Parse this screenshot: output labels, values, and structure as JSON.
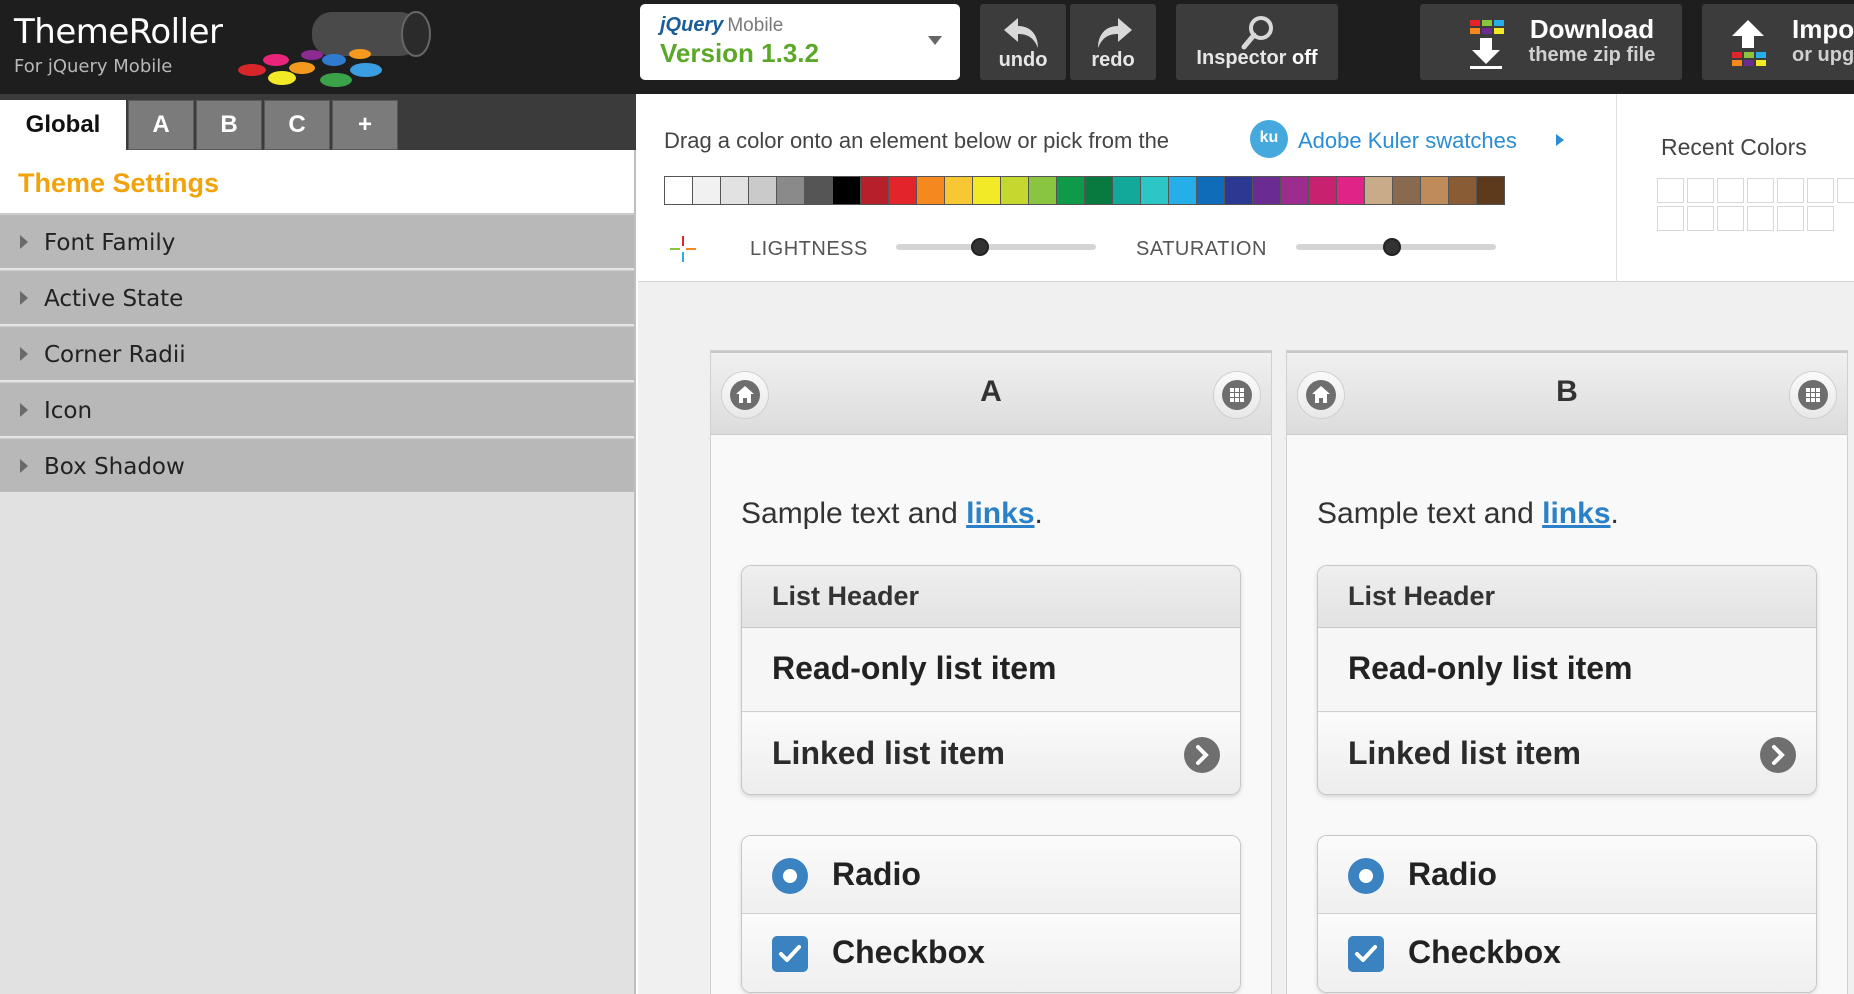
{
  "app": {
    "title": "ThemeRoller",
    "subtitle": "For jQuery Mobile"
  },
  "version": {
    "brand": "jQuery",
    "product": "Mobile",
    "label": "Version 1.3.2"
  },
  "toolbar": {
    "undo": "undo",
    "redo": "redo",
    "inspector": "Inspector",
    "inspector_state": "off",
    "download_main": "Download",
    "download_sub": "theme zip file",
    "import_main": "Impo",
    "import_sub": "or upg"
  },
  "left": {
    "tabs": [
      "Global",
      "A",
      "B",
      "C",
      "+"
    ],
    "active_tab": "Global",
    "settings_title": "Theme Settings",
    "sections": [
      "Font Family",
      "Active State",
      "Corner Radii",
      "Icon",
      "Box Shadow"
    ]
  },
  "palette": {
    "instruction": "Drag a color onto an element below or pick from the",
    "kuler_badge": "ku",
    "kuler_link": "Adobe Kuler swatches",
    "swatches": [
      "#ffffff",
      "#f1f1f1",
      "#e2e2e2",
      "#cacaca",
      "#8a8a8a",
      "#555555",
      "#000000",
      "#b71f2a",
      "#e3242b",
      "#f5891f",
      "#f8c834",
      "#f2ea27",
      "#c5d82f",
      "#8ac542",
      "#0e9a48",
      "#087a3f",
      "#12a89a",
      "#2dc6c6",
      "#25aee7",
      "#0f6cb8",
      "#2c3993",
      "#6a2c91",
      "#9c2d8f",
      "#c8216f",
      "#e02487",
      "#c9ab8a",
      "#8a6a4f",
      "#c08b5a",
      "#8a5c35",
      "#5e3a1c"
    ],
    "lightness_label": "LIGHTNESS",
    "lightness_value": 0.42,
    "saturation_label": "SATURATION",
    "saturation_value": 0.48,
    "recent_title": "Recent Colors"
  },
  "preview": {
    "themes": [
      {
        "title": "A",
        "sample_prefix": "Sample text and ",
        "sample_link": "links",
        "sample_suffix": ".",
        "list_header": "List Header",
        "readonly_item": "Read-only list item",
        "linked_item": "Linked list item",
        "radio": "Radio",
        "checkbox": "Checkbox"
      },
      {
        "title": "B",
        "sample_prefix": "Sample text and ",
        "sample_link": "links",
        "sample_suffix": ".",
        "list_header": "List Header",
        "readonly_item": "Read-only list item",
        "linked_item": "Linked list item",
        "radio": "Radio",
        "checkbox": "Checkbox"
      }
    ]
  },
  "icons": {
    "undo": "undo-arrow-icon",
    "redo": "redo-arrow-icon",
    "inspector": "magnifier-icon",
    "download": "download-arrow-icon",
    "import": "upload-arrow-icon",
    "eyedropper": "crosshair-icon",
    "home": "home-icon",
    "grid": "grid-icon",
    "chevron": "chevron-right-icon"
  }
}
